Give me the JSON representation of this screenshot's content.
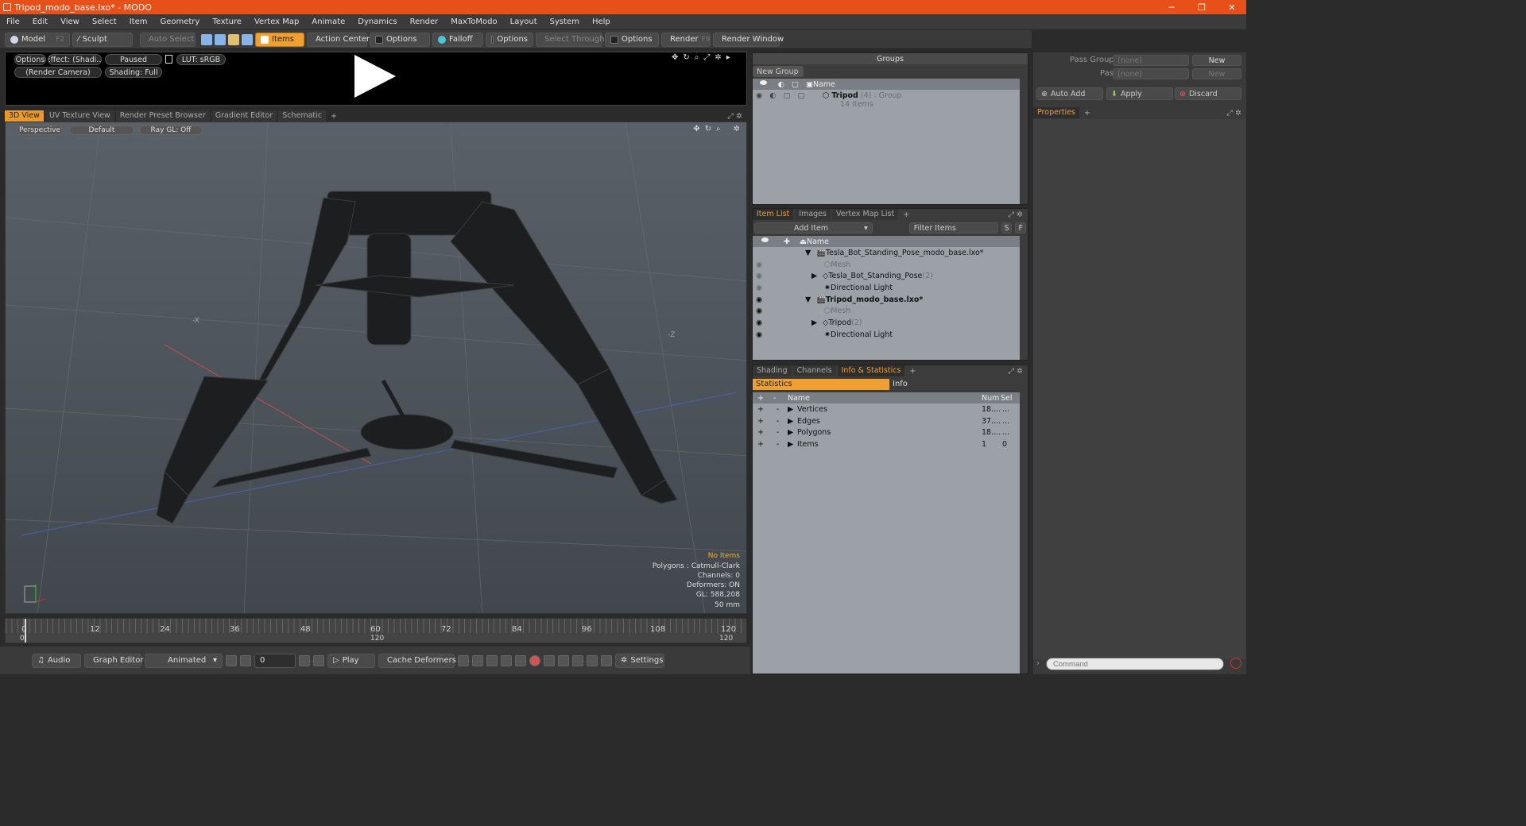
{
  "window": {
    "title": "Tripod_modo_base.lxo* - MODO",
    "minimize": "─",
    "maximize": "❐",
    "close": "✕"
  },
  "menu": [
    "File",
    "Edit",
    "View",
    "Select",
    "Item",
    "Geometry",
    "Texture",
    "Vertex Map",
    "Animate",
    "Dynamics",
    "Render",
    "MaxToModo",
    "Layout",
    "System",
    "Help"
  ],
  "toolbar": {
    "model": "Model",
    "model_key": "F2",
    "sculpt": "Sculpt",
    "auto_select": "Auto Select",
    "items": "Items",
    "action_center": "Action Center",
    "options1": "Options",
    "falloff": "Falloff",
    "options2": "Options",
    "select_through": "Select Through",
    "options3": "Options",
    "render": "Render",
    "render_key": "F9",
    "render_window": "Render Window"
  },
  "preview": {
    "options": "Options",
    "effect": "Effect: (Shadi...",
    "paused": "Paused",
    "lut": "LUT: sRGB",
    "camera": "(Render Camera)",
    "shading": "Shading: Full"
  },
  "view_tabs": [
    "3D View",
    "UV Texture View",
    "Render Preset Browser",
    "Gradient Editor",
    "Schematic"
  ],
  "viewport": {
    "perspective": "Perspective",
    "default": "Default",
    "raygl": "Ray GL: Off",
    "axis_x": "-X",
    "axis_z": "-Z",
    "stats": {
      "no_items": "No Items",
      "polygons": "Polygons : Catmull-Clark",
      "channels": "Channels: 0",
      "deformers": "Deformers: ON",
      "gl": "GL: 588,208",
      "focal": "50 mm"
    }
  },
  "timeline": {
    "ticks": [
      "0",
      "12",
      "24",
      "36",
      "48",
      "60",
      "72",
      "84",
      "96",
      "108",
      "120"
    ],
    "start": "0",
    "mid": "120",
    "end": "120"
  },
  "bottom": {
    "audio": "Audio",
    "graph_editor": "Graph Editor",
    "animated": "Animated",
    "frame": "0",
    "play": "Play",
    "cache": "Cache Deformers",
    "settings": "Settings"
  },
  "groups": {
    "title": "Groups",
    "new_group": "New Group",
    "col_name": "Name",
    "group_name": "Tripod",
    "group_count": "(4)",
    "group_type": ": Group",
    "group_items": "14 Items"
  },
  "pass": {
    "pass_groups": "Pass Groups",
    "passes": "Passes",
    "none1": "(none)",
    "none2": "(none)",
    "new1": "New",
    "new2": "New",
    "auto_add": "Auto Add",
    "apply": "Apply",
    "discard": "Discard",
    "properties": "Properties"
  },
  "itemlist": {
    "tabs": [
      "Item List",
      "Images",
      "Vertex Map List"
    ],
    "add_item": "Add Item",
    "filter": "Filter Items",
    "s": "S",
    "f": "F",
    "col_name": "Name",
    "rows": [
      {
        "label": "Tesla_Bot_Standing_Pose_modo_base.lxo*",
        "extra": ""
      },
      {
        "label": "Mesh",
        "extra": ""
      },
      {
        "label": "Tesla_Bot_Standing_Pose",
        "extra": "(2)"
      },
      {
        "label": "Directional Light",
        "extra": ""
      },
      {
        "label": "Tripod_modo_base.lxo*",
        "extra": ""
      },
      {
        "label": "Mesh",
        "extra": ""
      },
      {
        "label": "Tripod",
        "extra": "(2)"
      },
      {
        "label": "Directional Light",
        "extra": ""
      }
    ]
  },
  "info": {
    "tabs": [
      "Shading",
      "Channels",
      "Info & Statistics"
    ],
    "statistics": "Statistics",
    "info": "Info",
    "cols": {
      "name": "Name",
      "num": "Num",
      "sel": "Sel"
    },
    "rows": [
      {
        "name": "Vertices",
        "num": "18....",
        "sel": "..."
      },
      {
        "name": "Edges",
        "num": "37....",
        "sel": "..."
      },
      {
        "name": "Polygons",
        "num": "18....",
        "sel": "..."
      },
      {
        "name": "Items",
        "num": "1",
        "sel": "0"
      }
    ]
  },
  "command": {
    "placeholder": "Command"
  },
  "colors": {
    "accent": "#e8501a",
    "highlight": "#f0a030"
  }
}
